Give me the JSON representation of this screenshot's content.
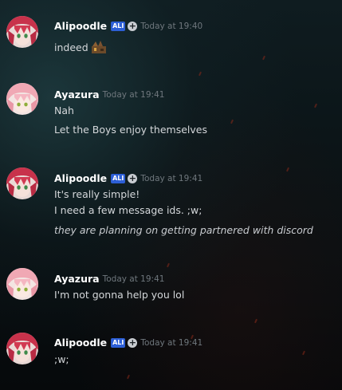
{
  "messages": [
    {
      "author": "Alipoodle",
      "tag": "ALI",
      "timestamp": "Today at 19:40",
      "avatar": "red-hair-avatar",
      "lines": [
        "indeed"
      ],
      "emoji": "custom-emoji"
    },
    {
      "author": "Ayazura",
      "timestamp": "Today at 19:41",
      "avatar": "pink-hair-avatar",
      "lines": [
        "Nah",
        "Let the Boys enjoy themselves"
      ]
    },
    {
      "author": "Alipoodle",
      "tag": "ALI",
      "timestamp": "Today at 19:41",
      "avatar": "red-hair-avatar",
      "lines": [
        "It's really simple!",
        "I need a few message ids. ;w;"
      ],
      "italic_line": "they are planning on getting partnered with discord"
    },
    {
      "author": "Ayazura",
      "timestamp": "Today at 19:41",
      "avatar": "pink-hair-avatar",
      "lines": [
        "I'm not gonna help you  lol"
      ]
    },
    {
      "author": "Alipoodle",
      "tag": "ALI",
      "timestamp": "Today at 19:41",
      "avatar": "red-hair-avatar",
      "lines": [
        ";w;"
      ]
    }
  ],
  "colors": {
    "tag_blue": "#2d5fd6",
    "username": "#ffffff",
    "timestamp": "#6f777d",
    "text": "#d4d7da"
  }
}
